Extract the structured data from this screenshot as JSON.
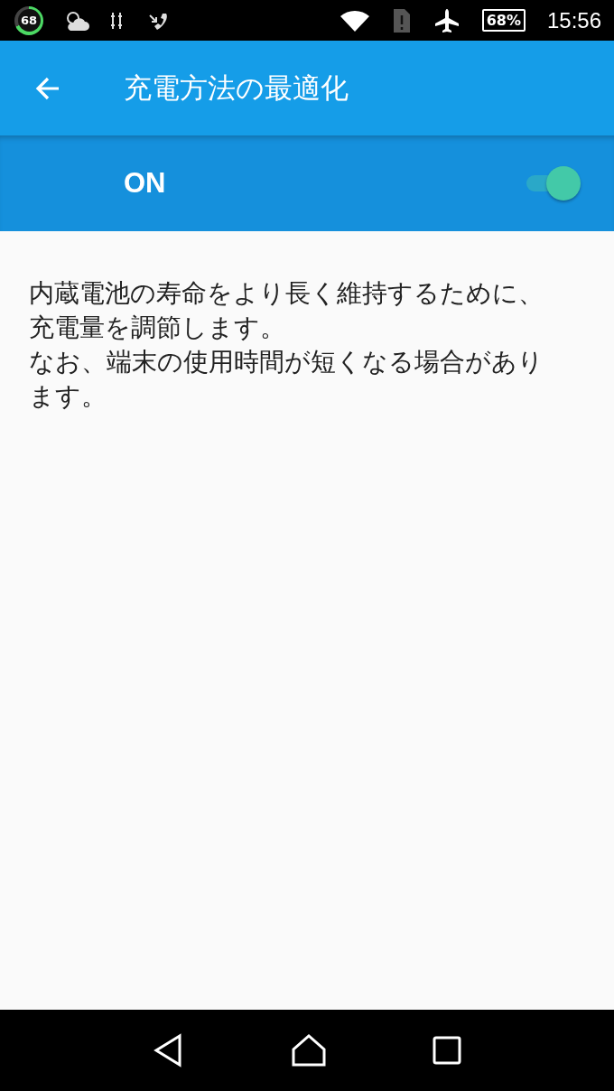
{
  "status_bar": {
    "badge": "68",
    "battery": "68%",
    "time": "15:56"
  },
  "app_bar": {
    "title": "充電方法の最適化"
  },
  "master_switch": {
    "label": "ON",
    "on": true
  },
  "description": [
    "内蔵電池の寿命をより長く維持するために、充電量を調節します。",
    "なお、端末の使用時間が短くなる場合があります。"
  ]
}
